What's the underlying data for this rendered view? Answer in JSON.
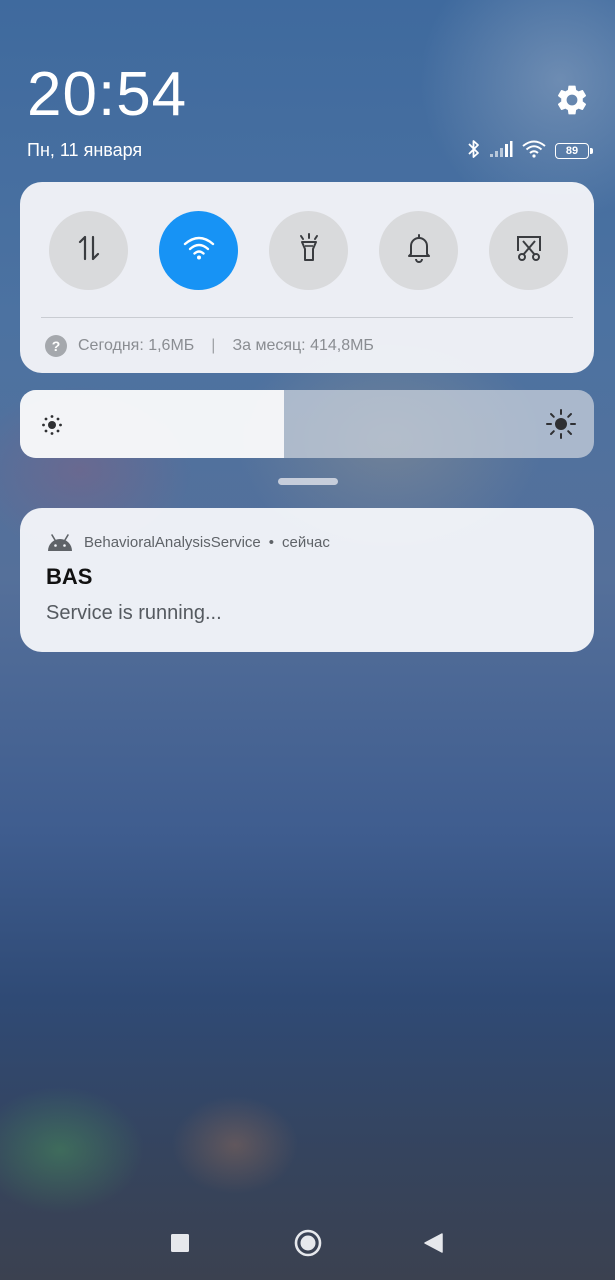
{
  "status": {
    "time": "20:54",
    "date": "Пн, 11 января",
    "battery_level": "89",
    "icons": [
      "bluetooth-icon",
      "signal-icon",
      "wifi-icon",
      "battery-icon"
    ]
  },
  "quick_settings": {
    "toggles": [
      {
        "name": "mobile-data",
        "icon": "arrows-updown-icon",
        "active": false
      },
      {
        "name": "wifi",
        "icon": "wifi-icon",
        "active": true
      },
      {
        "name": "flashlight",
        "icon": "flashlight-icon",
        "active": false
      },
      {
        "name": "sound",
        "icon": "bell-icon",
        "active": false
      },
      {
        "name": "screenshot",
        "icon": "scissors-screenshot-icon",
        "active": false
      }
    ],
    "data_usage": {
      "today": "Сегодня: 1,6МБ",
      "separator": "|",
      "month": "За месяц: 414,8МБ"
    },
    "accent_color": "#1793f5"
  },
  "brightness": {
    "level_percent": 46
  },
  "notification": {
    "app_name": "BehavioralAnalysisService",
    "separator": "•",
    "time": "сейчас",
    "title": "BAS",
    "text": "Service is running..."
  },
  "navbar": {
    "buttons": [
      "recents-button",
      "home-button",
      "back-button"
    ]
  }
}
